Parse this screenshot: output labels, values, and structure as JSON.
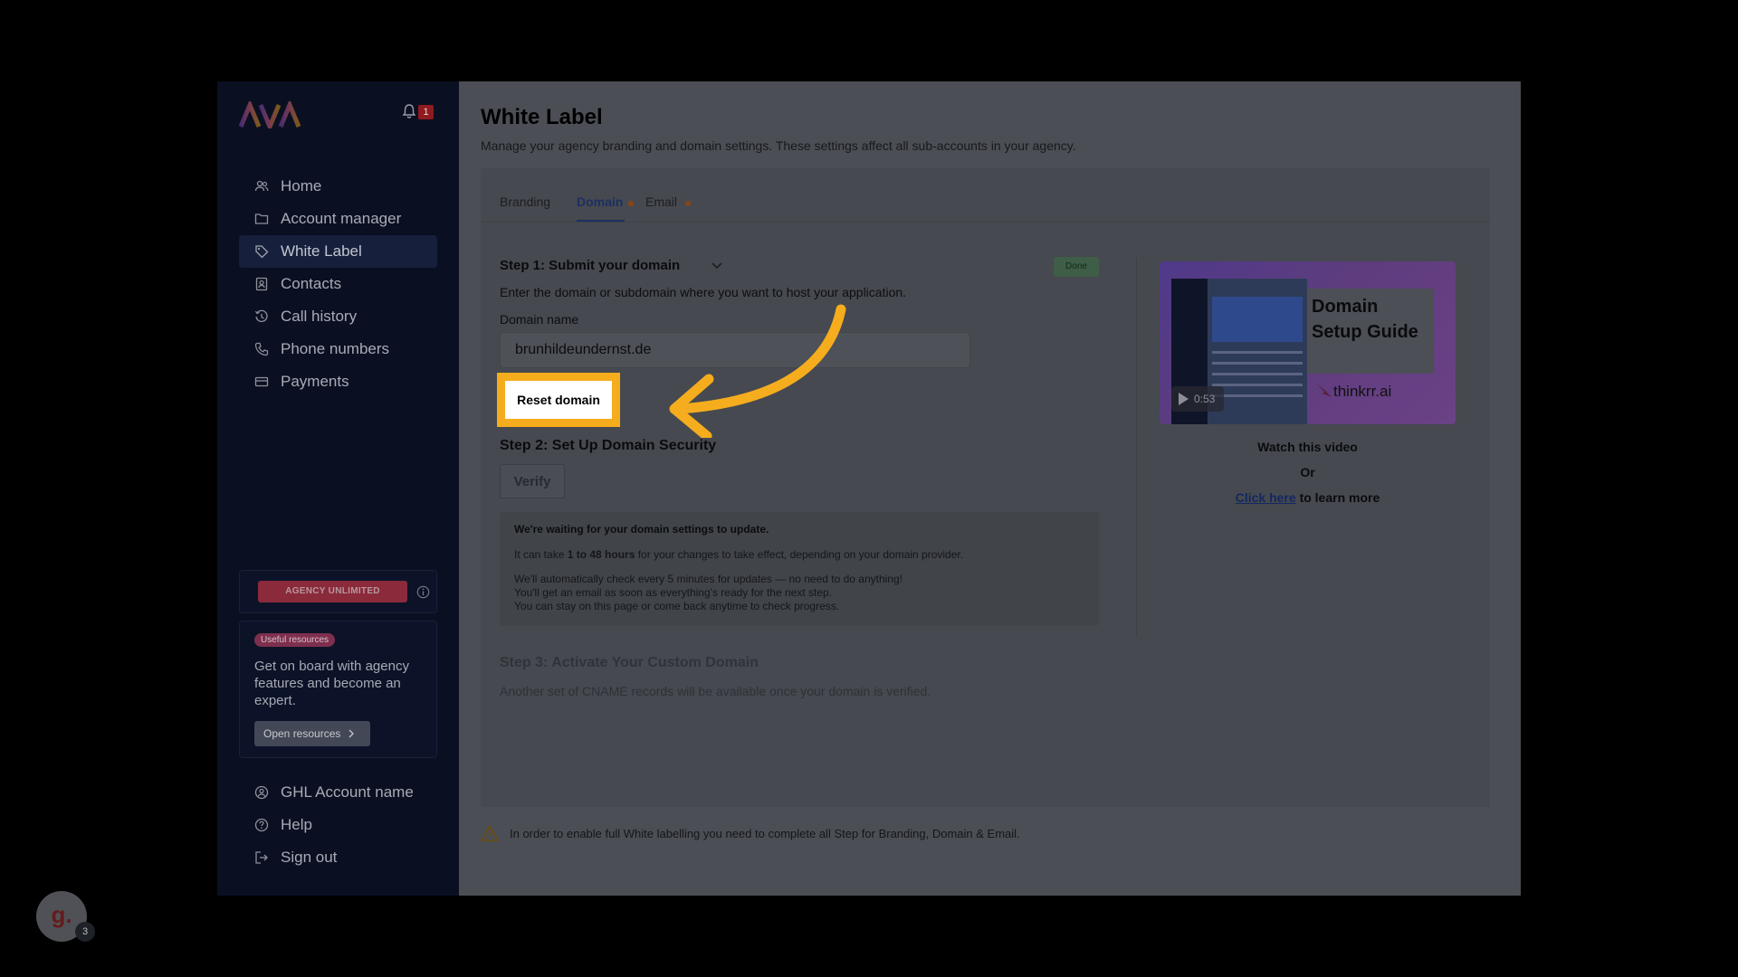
{
  "sidebar": {
    "notification_count": "1",
    "items": [
      {
        "label": "Home",
        "icon": "users-icon"
      },
      {
        "label": "Account manager",
        "icon": "folder-icon"
      },
      {
        "label": "White Label",
        "icon": "tag-icon",
        "active": true
      },
      {
        "label": "Contacts",
        "icon": "contacts-icon"
      },
      {
        "label": "Call history",
        "icon": "history-icon"
      },
      {
        "label": "Phone numbers",
        "icon": "phone-icon"
      },
      {
        "label": "Payments",
        "icon": "card-icon"
      }
    ],
    "plan_label": "AGENCY UNLIMITED",
    "resources": {
      "badge": "Useful resources",
      "text": "Get on board with agency features and become an expert.",
      "button": "Open resources"
    },
    "bottom_items": [
      {
        "label": "GHL Account name",
        "icon": "user-circle-icon"
      },
      {
        "label": "Help",
        "icon": "help-icon"
      },
      {
        "label": "Sign out",
        "icon": "sign-out-icon"
      }
    ]
  },
  "main": {
    "title": "White Label",
    "subtitle": "Manage your agency branding and domain settings. These settings affect all sub-accounts in your agency.",
    "tabs": [
      {
        "label": "Branding"
      },
      {
        "label": "Domain",
        "active": true
      },
      {
        "label": "Email"
      }
    ],
    "step1": {
      "title": "Step 1: Submit your domain",
      "status": "Done",
      "description": "Enter the domain or subdomain where you want to host your application.",
      "field_label": "Domain name",
      "field_value": "brunhildeundernst.de",
      "reset_label": "Reset domain"
    },
    "step2": {
      "title": "Step 2: Set Up Domain Security",
      "verify_label": "Verify",
      "wait_title": "We're waiting for your domain settings to update.",
      "wait_line1_pre": "It can take ",
      "wait_line1_bold": "1 to 48 hours",
      "wait_line1_post": " for your changes to take effect, depending on your domain provider.",
      "wait_line2": "We'll automatically check every 5 minutes for updates — no need to do anything!",
      "wait_line3": "You'll get an email as soon as everything's ready for the next step.",
      "wait_line4": "You can stay on this page or come back anytime to check progress."
    },
    "step3": {
      "title": "Step 3: Activate Your Custom Domain",
      "description": "Another set of CNAME records will be available once your domain is verified."
    },
    "video": {
      "title": "Domain Setup Guide",
      "brand": "thinkrr.ai",
      "duration": "0:53",
      "watch": "Watch this video",
      "or": "Or",
      "link": "Click here",
      "link_suffix": "to learn more"
    },
    "warning": "In order to enable full White labelling you need to complete all Step for Branding, Domain & Email."
  },
  "guide": {
    "avatar_letter": "g.",
    "count": "3"
  },
  "colors": {
    "highlight": "#f5ad1e",
    "accent": "#1d2f62"
  }
}
